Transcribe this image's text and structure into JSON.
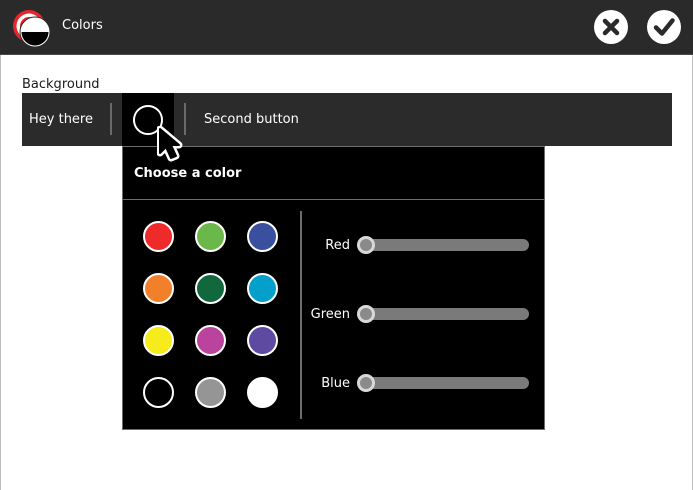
{
  "window": {
    "title": "Colors",
    "close_icon": "close-icon",
    "ok_icon": "checkmark-icon"
  },
  "content": {
    "background_label": "Background"
  },
  "toolbar": {
    "hey_label": "Hey there",
    "second_label": "Second button",
    "color_button_value": "#000000"
  },
  "popover": {
    "title": "Choose a color",
    "swatches": [
      {
        "name": "red",
        "color": "#ee2a2a"
      },
      {
        "name": "green",
        "color": "#6cb74a"
      },
      {
        "name": "blue",
        "color": "#3a4f9e"
      },
      {
        "name": "orange",
        "color": "#f27f2a"
      },
      {
        "name": "dark-green",
        "color": "#11683c"
      },
      {
        "name": "cyan",
        "color": "#049fcb"
      },
      {
        "name": "yellow",
        "color": "#f7ec1b"
      },
      {
        "name": "magenta",
        "color": "#ba439e"
      },
      {
        "name": "purple",
        "color": "#5e4ba1"
      },
      {
        "name": "black",
        "color": "#000000"
      },
      {
        "name": "gray",
        "color": "#959595"
      },
      {
        "name": "white",
        "color": "#ffffff"
      }
    ],
    "sliders": [
      {
        "label": "Red",
        "value": 0
      },
      {
        "label": "Green",
        "value": 0
      },
      {
        "label": "Blue",
        "value": 0
      }
    ]
  }
}
